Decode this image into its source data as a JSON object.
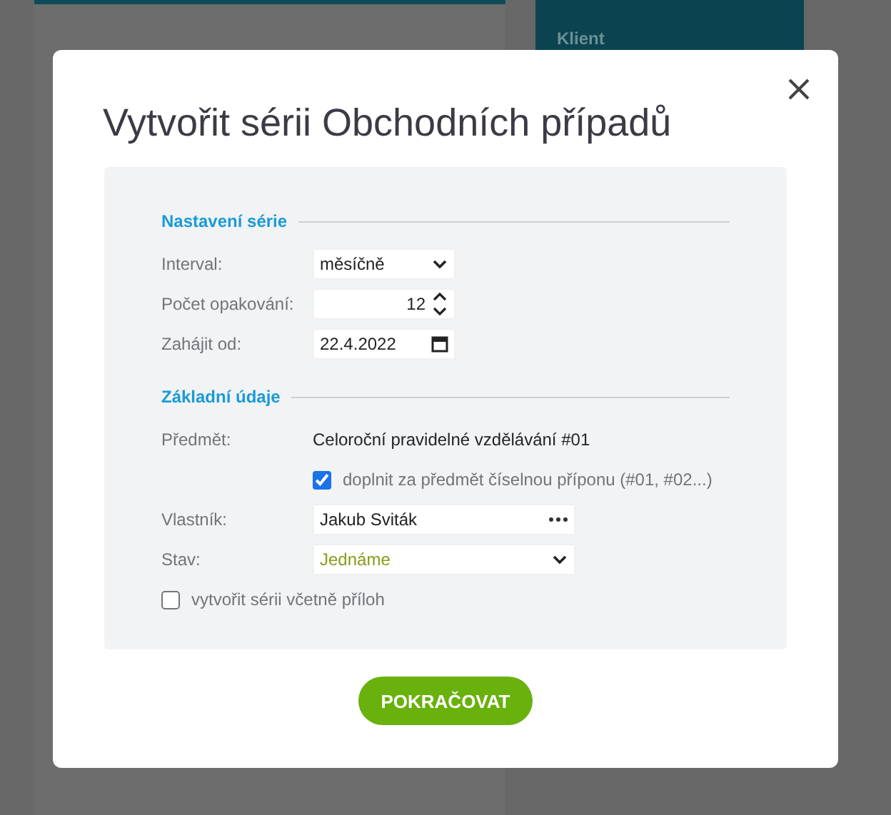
{
  "background": {
    "side_panel_label": "Klient"
  },
  "dialog": {
    "title": "Vytvořit sérii Obchodních případů",
    "sections": [
      {
        "heading": "Nastavení série",
        "fields": [
          {
            "kind": "select",
            "label": "Interval:",
            "value": "měsíčně"
          },
          {
            "kind": "number",
            "label": "Počet opakování:",
            "value": "12"
          },
          {
            "kind": "date",
            "label": "Zahájit od:",
            "value": "22.4.2022"
          }
        ]
      },
      {
        "heading": "Základní údaje",
        "fields": [
          {
            "kind": "text",
            "label": "Předmět:",
            "value": "Celoroční pravidelné vzdělávání #01"
          },
          {
            "kind": "checkbox",
            "label": "doplnit za předmět číselnou příponu (#01, #02...)",
            "checked": true,
            "indented": true
          },
          {
            "kind": "lookup",
            "label": "Vlastník:",
            "value": "Jakub Sviták"
          },
          {
            "kind": "status",
            "label": "Stav:",
            "value": "Jednáme"
          },
          {
            "kind": "checkbox",
            "label": "vytvořit sérii včetně příloh",
            "checked": false,
            "indented": false
          }
        ]
      }
    ],
    "button": "POKRAČOVAT"
  }
}
